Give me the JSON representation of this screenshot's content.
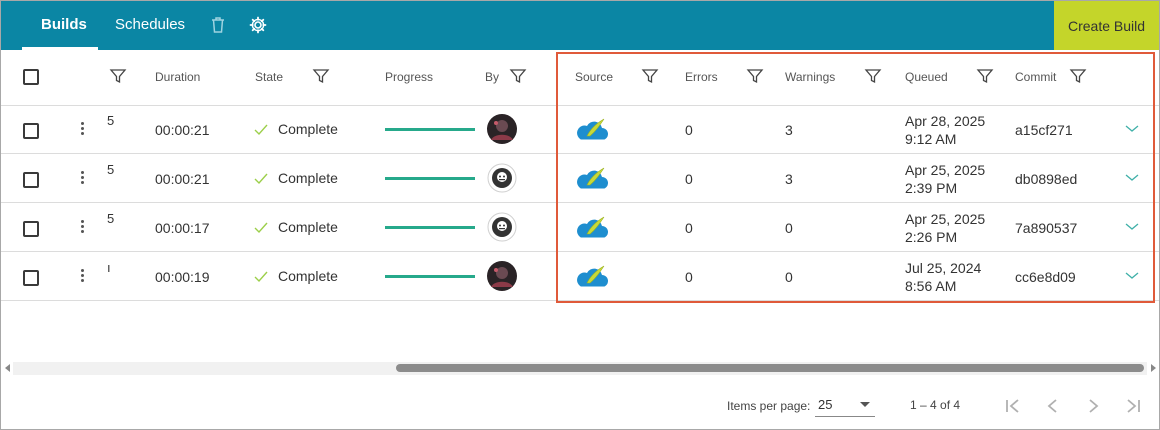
{
  "tabs": [
    {
      "label": "Builds",
      "active": true
    },
    {
      "label": "Schedules",
      "active": false
    }
  ],
  "toolbar_icons": [
    "trash-icon",
    "gear-icon"
  ],
  "create_label": "Create Build",
  "colors": {
    "topbar": "#0b86a4",
    "create": "#c4d52a",
    "progress": "#26a98b",
    "highlight": "#e05a3a"
  },
  "columns": {
    "duration": "Duration",
    "state": "State",
    "progress": "Progress",
    "by": "By",
    "source": "Source",
    "errors": "Errors",
    "warnings": "Warnings",
    "queued": "Queued",
    "commit": "Commit"
  },
  "rows": [
    {
      "id": "5",
      "duration": "00:00:21",
      "state": "Complete",
      "progress": 1.0,
      "avatar": "photo-avatar",
      "errors": "0",
      "warnings": "3",
      "queued_date": "Apr 28, 2025",
      "queued_time": "9:12 AM",
      "commit": "a15cf271"
    },
    {
      "id": "5",
      "duration": "00:00:21",
      "state": "Complete",
      "progress": 1.0,
      "avatar": "robot-avatar",
      "errors": "0",
      "warnings": "3",
      "queued_date": "Apr 25, 2025",
      "queued_time": "2:39 PM",
      "commit": "db0898ed"
    },
    {
      "id": "5",
      "duration": "00:00:17",
      "state": "Complete",
      "progress": 1.0,
      "avatar": "robot-avatar",
      "errors": "0",
      "warnings": "0",
      "queued_date": "Apr 25, 2025",
      "queued_time": "2:26 PM",
      "commit": "7a890537"
    },
    {
      "id": "ı",
      "duration": "00:00:19",
      "state": "Complete",
      "progress": 1.0,
      "avatar": "photo-avatar",
      "errors": "0",
      "warnings": "0",
      "queued_date": "Jul 25, 2024",
      "queued_time": "8:56 AM",
      "commit": "cc6e8d09"
    }
  ],
  "footer": {
    "items_per_page_label": "Items per page:",
    "items_per_page_value": "25",
    "range": "1 – 4 of 4"
  }
}
